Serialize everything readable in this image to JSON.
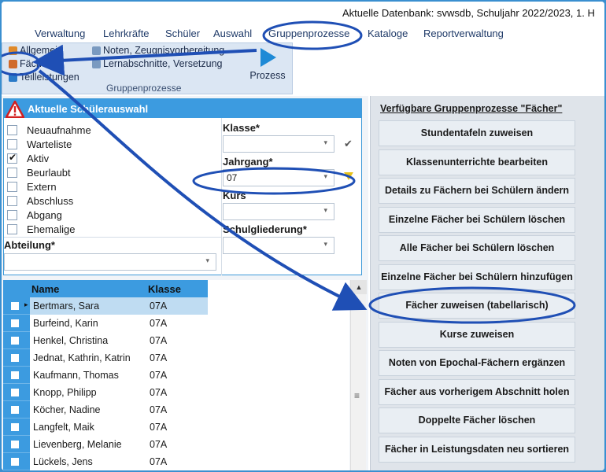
{
  "title": "Aktuelle Datenbank: svwsdb, Schuljahr 2022/2023, 1. H",
  "menu": [
    "Verwaltung",
    "Lehrkräfte",
    "Schüler",
    "Auswahl",
    "Gruppenprozesse",
    "Kataloge",
    "Reportverwaltung"
  ],
  "ribbon": {
    "items_left": [
      "Allgemein",
      "Fächer",
      "Teilleistungen"
    ],
    "items_mid": [
      "Noten, Zeugnisvorbereitung",
      "Lernabschnitte, Versetzung"
    ],
    "group_label": "Gruppenprozesse",
    "process_label": "Prozess"
  },
  "selection": {
    "header": "Aktuelle Schülerauswahl",
    "statuses": [
      {
        "label": "Neuaufnahme",
        "checked": false
      },
      {
        "label": "Warteliste",
        "checked": false
      },
      {
        "label": "Aktiv",
        "checked": true
      },
      {
        "label": "Beurlaubt",
        "checked": false
      },
      {
        "label": "Extern",
        "checked": false
      },
      {
        "label": "Abschluss",
        "checked": false
      },
      {
        "label": "Abgang",
        "checked": false
      },
      {
        "label": "Ehemalige",
        "checked": false
      }
    ],
    "abteilung_label": "Abteilung*",
    "klasse_label": "Klasse*",
    "jahrgang_label": "Jahrgang*",
    "jahrgang_value": "07",
    "kurs_label": "Kurs",
    "schulgliederung_label": "Schulgliederung*"
  },
  "grid": {
    "col_name": "Name",
    "col_klasse": "Klasse",
    "rows": [
      {
        "name": "Bertmars, Sara",
        "klasse": "07A"
      },
      {
        "name": "Burfeind, Karin",
        "klasse": "07A"
      },
      {
        "name": "Henkel, Christina",
        "klasse": "07A"
      },
      {
        "name": "Jednat, Kathrin, Katrin",
        "klasse": "07A"
      },
      {
        "name": "Kaufmann, Thomas",
        "klasse": "07A"
      },
      {
        "name": "Knopp, Philipp",
        "klasse": "07A"
      },
      {
        "name": "Köcher, Nadine",
        "klasse": "07A"
      },
      {
        "name": "Langfelt, Maik",
        "klasse": "07A"
      },
      {
        "name": "Lievenberg, Melanie",
        "klasse": "07A"
      },
      {
        "name": "Lückels, Jens",
        "klasse": "07A"
      }
    ]
  },
  "processes": {
    "title": "Verfügbare Gruppenprozesse \"Fächer\"",
    "buttons": [
      "Stundentafeln zuweisen",
      "Klassenunterrichte bearbeiten",
      "Details zu Fächern bei Schülern ändern",
      "Einzelne Fächer bei Schülern löschen",
      "Alle Fächer bei Schülern löschen",
      "Einzelne Fächer bei Schülern hinzufügen",
      "Fächer zuweisen (tabellarisch)",
      "Kurse zuweisen",
      "Noten von Epochal-Fächern ergänzen",
      "Fächer aus vorherigem Abschnitt holen",
      "Doppelte Fächer löschen",
      "Fächer in Leistungsdaten neu sortieren"
    ]
  },
  "colors": {
    "accent": "#3c9be0",
    "annotation": "#1f4fb5"
  }
}
